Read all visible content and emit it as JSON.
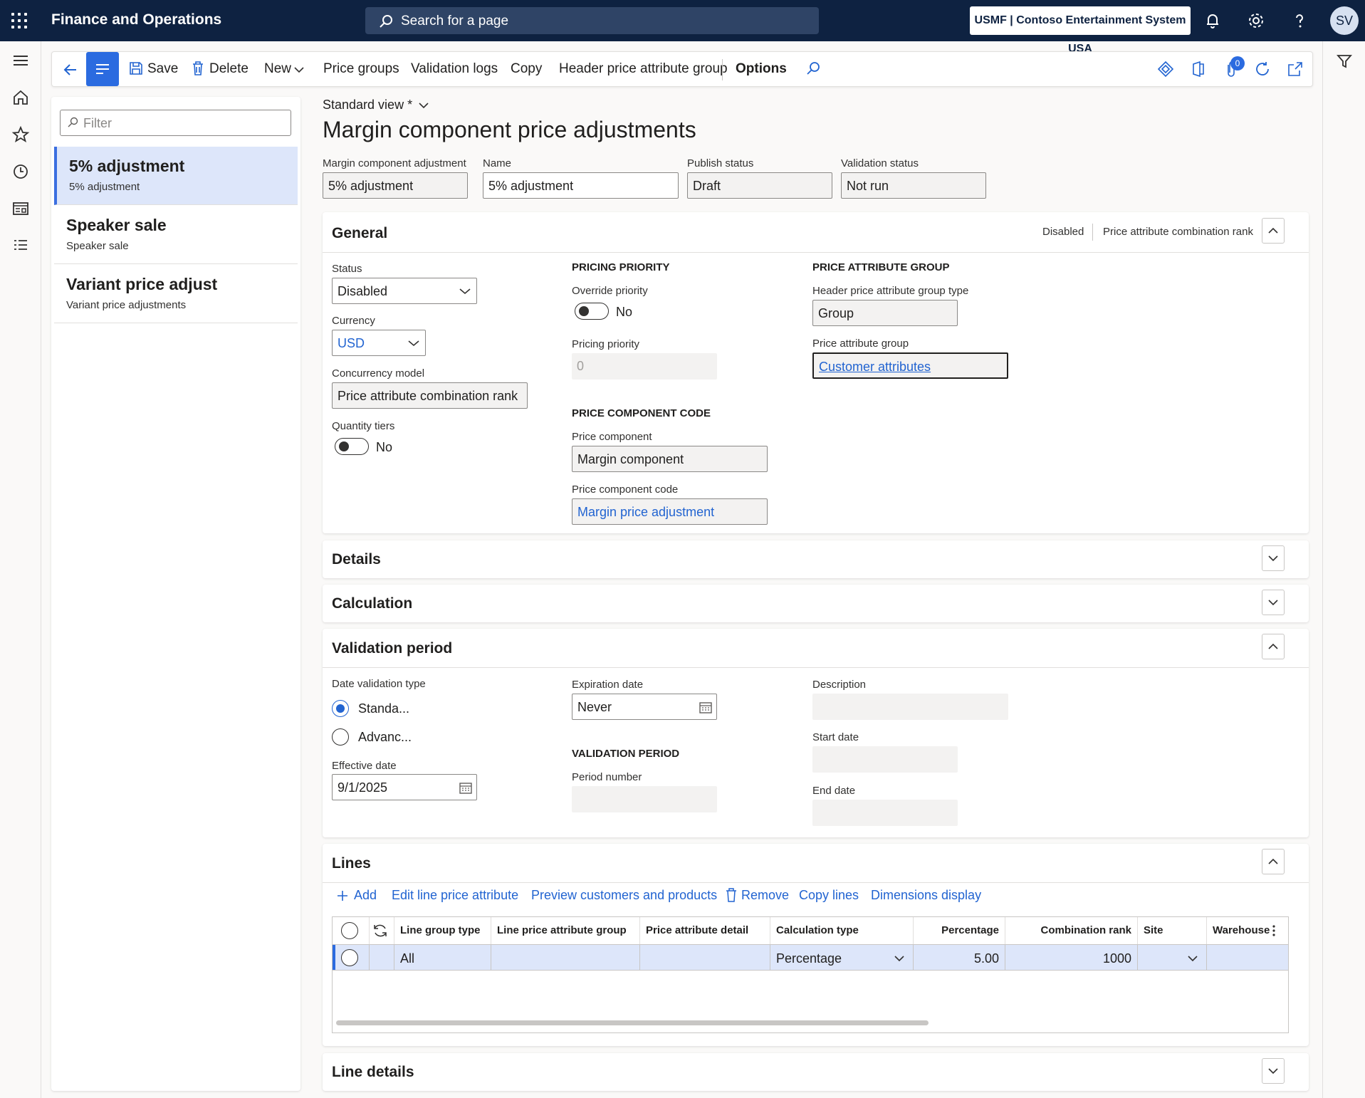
{
  "app": {
    "title": "Finance and Operations",
    "search_placeholder": "Search for a page",
    "company": "USMF | Contoso Entertainment System USA",
    "avatar": "SV",
    "notification_count": "0"
  },
  "actionbar": {
    "save": "Save",
    "delete": "Delete",
    "new": "New",
    "price_groups": "Price groups",
    "validation_logs": "Validation logs",
    "copy": "Copy",
    "header_group": "Header price attribute group",
    "options": "Options"
  },
  "navpane": {
    "filter_placeholder": "Filter",
    "items": [
      {
        "title": "5% adjustment",
        "subtitle": "5% adjustment"
      },
      {
        "title": "Speaker sale",
        "subtitle": "Speaker sale"
      },
      {
        "title": "Variant price adjust",
        "subtitle": "Variant price adjustments"
      }
    ]
  },
  "page": {
    "view": "Standard view *",
    "title": "Margin component price adjustments",
    "header_fields": {
      "adjustment_label": "Margin component adjustment",
      "adjustment_value": "5% adjustment",
      "name_label": "Name",
      "name_value": "5% adjustment",
      "publish_label": "Publish status",
      "publish_value": "Draft",
      "validation_label": "Validation status",
      "validation_value": "Not run"
    }
  },
  "general": {
    "header": "General",
    "summary1": "Disabled",
    "summary2": "Price attribute combination rank",
    "status_label": "Status",
    "status_value": "Disabled",
    "currency_label": "Currency",
    "currency_value": "USD",
    "concurrency_label": "Concurrency model",
    "concurrency_value": "Price attribute combination rank",
    "tiers_label": "Quantity tiers",
    "tiers_value": "No",
    "pricing_priority_heading": "PRICING PRIORITY",
    "override_label": "Override priority",
    "override_value": "No",
    "priority_label": "Pricing priority",
    "priority_value": "0",
    "component_heading": "PRICE COMPONENT CODE",
    "component_label": "Price component",
    "component_value": "Margin component",
    "code_label": "Price component code",
    "code_value": "Margin price adjustment",
    "attr_heading": "PRICE ATTRIBUTE GROUP",
    "header_type_label": "Header price attribute group type",
    "header_type_value": "Group",
    "attr_group_label": "Price attribute group",
    "attr_group_value": "Customer attributes"
  },
  "details": {
    "header": "Details"
  },
  "calculation": {
    "header": "Calculation"
  },
  "validation": {
    "header": "Validation period",
    "date_type_label": "Date validation type",
    "opt_standard": "Standa...",
    "opt_advanced": "Advanc...",
    "effective_label": "Effective date",
    "effective_value": "9/1/2025",
    "expiration_label": "Expiration date",
    "expiration_value": "Never",
    "period_heading": "VALIDATION PERIOD",
    "period_number_label": "Period number",
    "description_label": "Description",
    "start_label": "Start date",
    "end_label": "End date"
  },
  "lines": {
    "header": "Lines",
    "actions": {
      "add": "Add",
      "edit": "Edit line price attribute",
      "preview": "Preview customers and products",
      "remove": "Remove",
      "copy": "Copy lines",
      "dimensions": "Dimensions display"
    },
    "columns": [
      "Line group type",
      "Line price attribute group",
      "Price attribute detail",
      "Calculation type",
      "Percentage",
      "Combination rank",
      "Site",
      "Warehouse"
    ],
    "rows": [
      {
        "line_group_type": "All",
        "line_price_attribute_group": "",
        "price_attribute_detail": "",
        "calculation_type": "Percentage",
        "percentage": "5.00",
        "combination_rank": "1000",
        "site": "",
        "warehouse": ""
      }
    ]
  },
  "line_details": {
    "header": "Line details"
  }
}
